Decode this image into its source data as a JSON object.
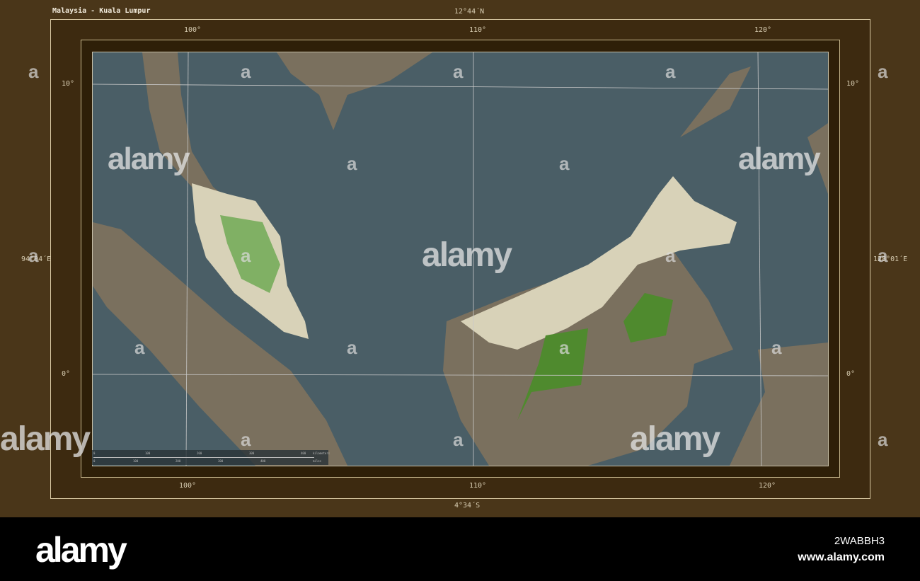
{
  "title": "Malaysia - Kuala Lumpur",
  "bounds": {
    "north": "12°44´N",
    "south": "4°34´S",
    "west": "94°04´E",
    "east": "128°01´E"
  },
  "longitude_ticks": [
    "100°",
    "110°",
    "120°"
  ],
  "latitude_ticks": [
    "10°",
    "0°"
  ],
  "scale_bar": {
    "km_labels": [
      "0",
      "100",
      "200",
      "300",
      "400"
    ],
    "km_unit": "kilometers",
    "mi_labels": [
      "0",
      "100",
      "200",
      "300",
      "400"
    ],
    "mi_unit": "miles"
  },
  "watermark": {
    "text": "alamy",
    "mark": "a"
  },
  "banner": {
    "logo": "alamy",
    "image_id": "2WABBH3",
    "site": "www.alamy.com"
  },
  "colors": {
    "frame": "#4a3619",
    "sea": "#4a5e66",
    "land_country": "#d8d2b8",
    "land_other": "#7a705e",
    "forest": "#4f8a2e"
  }
}
